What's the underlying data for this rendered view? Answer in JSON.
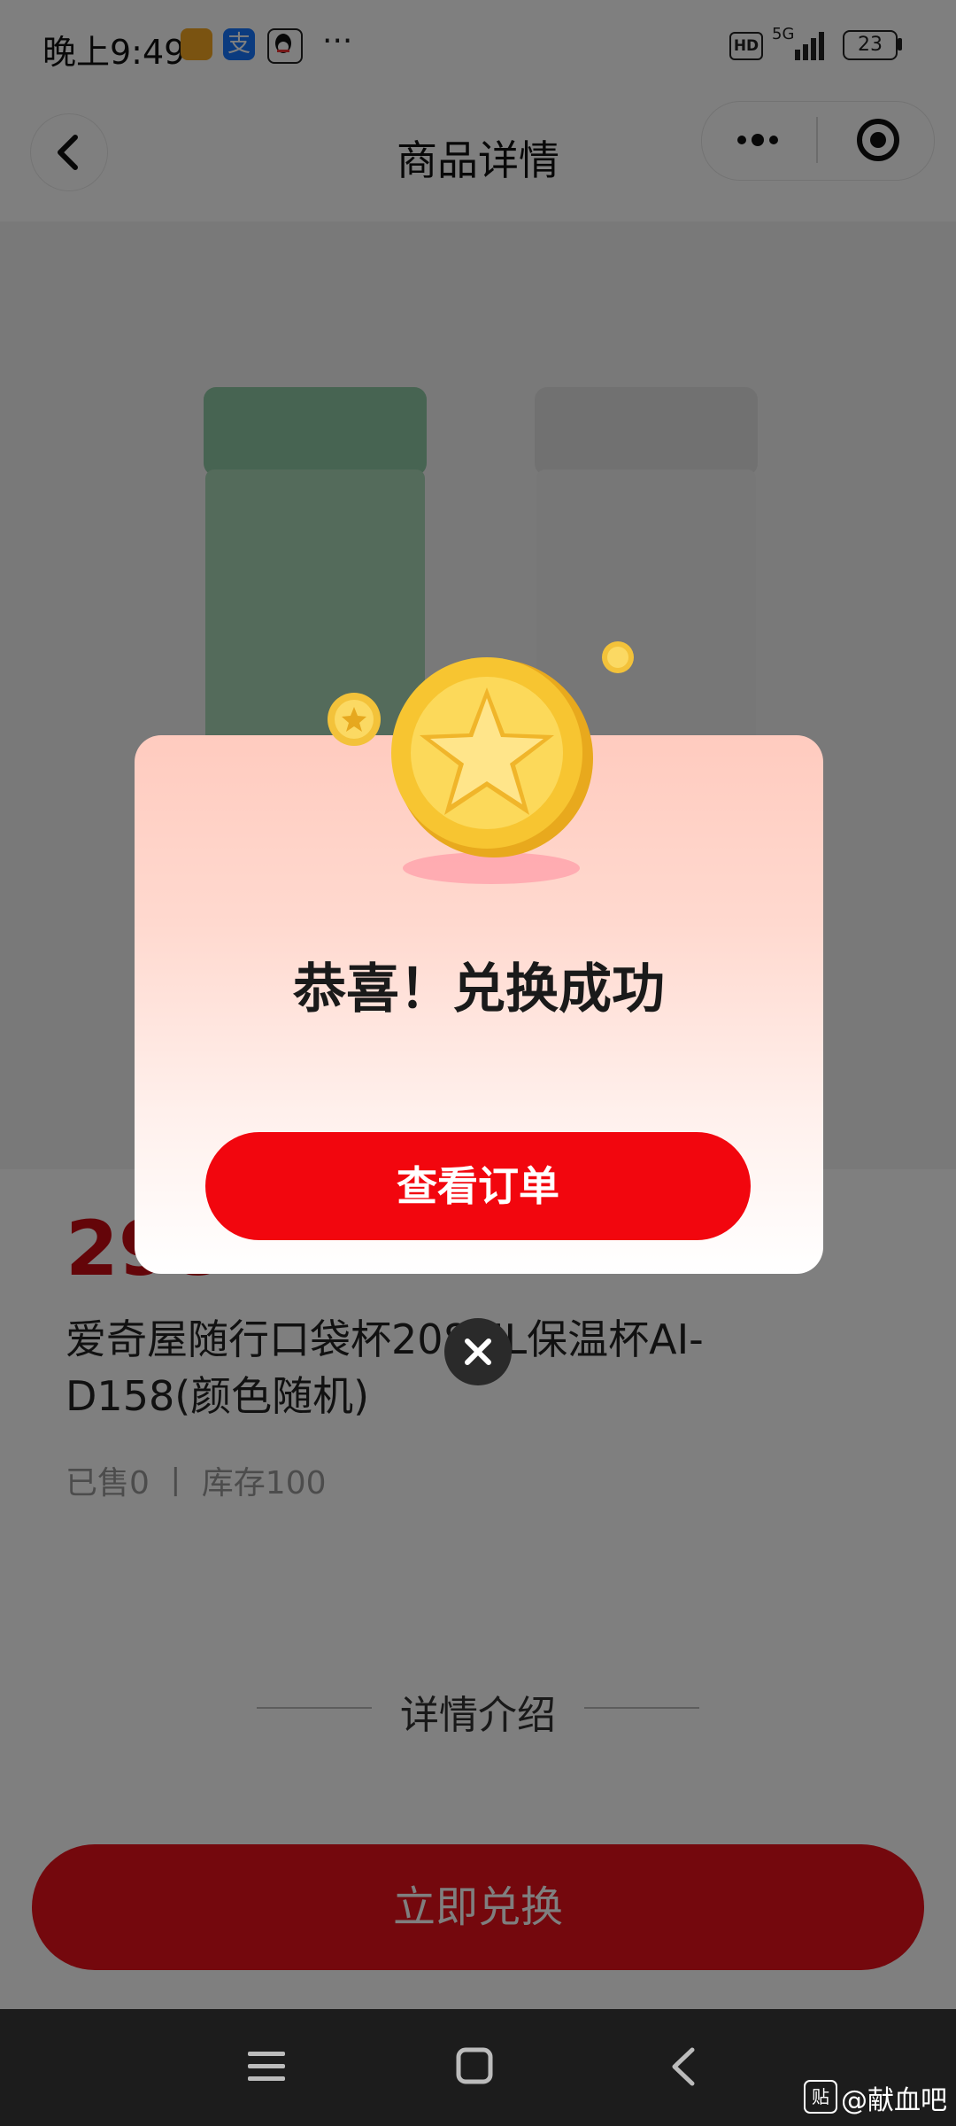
{
  "status_bar": {
    "time": "晚上9:49",
    "more": "···",
    "network": "5G",
    "hd": "HD",
    "battery": "23"
  },
  "navbar": {
    "title": "商品详情"
  },
  "product": {
    "price": "298",
    "name": "爱奇屋随行口袋杯208ML保温杯AI-D158(颜色随机)",
    "sales_stock": "已售0 丨 库存100",
    "detail_title": "详情介绍",
    "redeem_label": "立即兑换"
  },
  "modal": {
    "title": "恭喜！兑换成功",
    "view_order_label": "查看订单"
  },
  "watermark": "@献血吧",
  "colors": {
    "brand_red": "#f2060e",
    "price_red": "#c80a12",
    "modal_top": "#ffcbbf",
    "coin_gold": "#f7c531"
  }
}
